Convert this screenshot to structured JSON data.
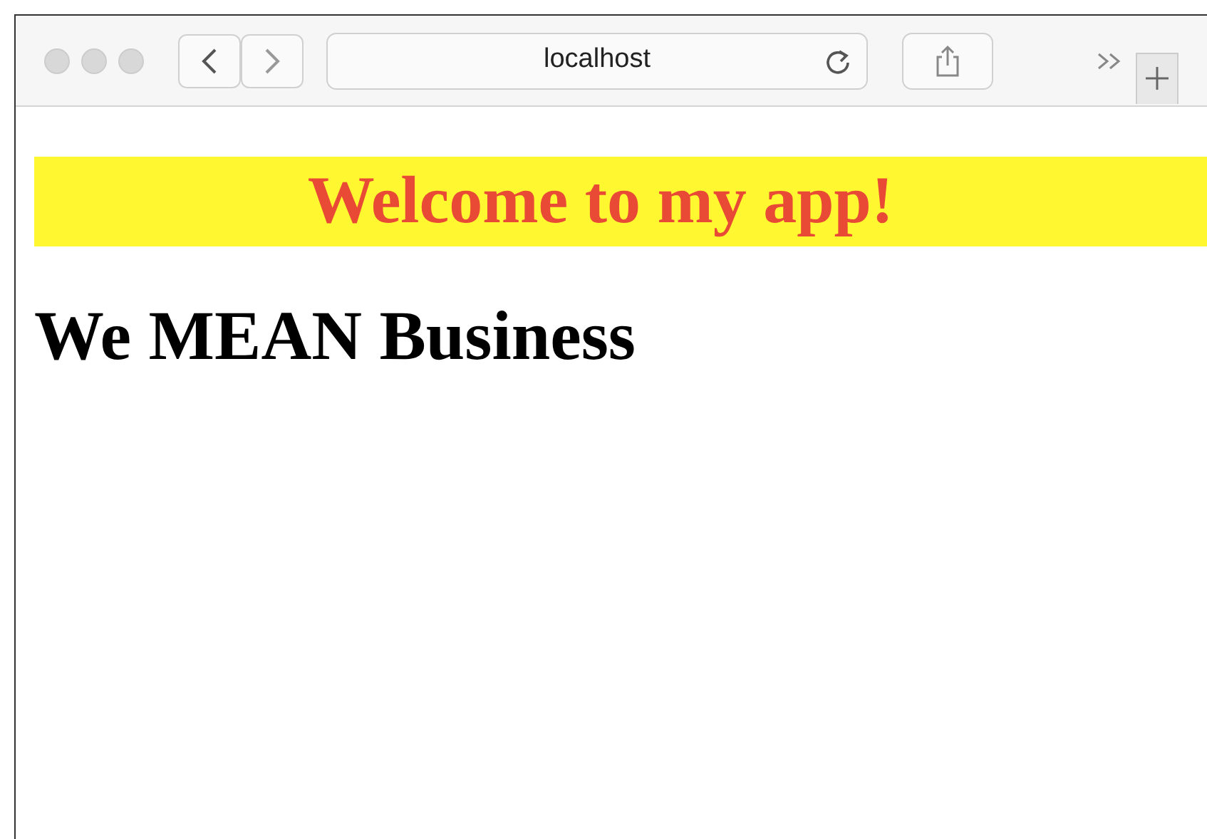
{
  "browser": {
    "address": "localhost"
  },
  "page": {
    "banner": "Welcome to my app!",
    "heading": "We MEAN Business"
  }
}
